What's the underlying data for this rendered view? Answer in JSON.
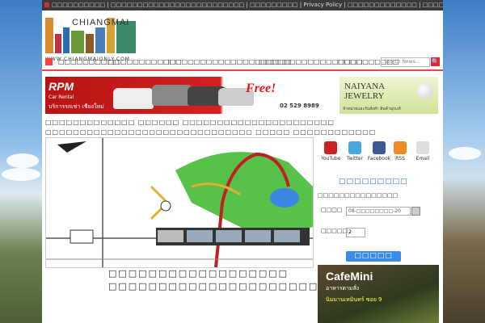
{
  "topbar": {
    "items": [
      "□□□□□□□□□□ | □□□□□□□□□□□□□□□□□□□□□□□□□ | □□□□□□□□□ | Privacy Policy | □□□□□□□□□□□□□ | □□□□□□□□□□□□□□□□□□□□□□□□"
    ]
  },
  "logo": {
    "text": "CHIANGMAI",
    "url": "WWW.CHIANGMAIONLY.COM"
  },
  "nav": {
    "items": [
      "□□□□□□□□□□",
      "□□□□□□□□□□□□",
      "□□□□□□□□□□□□□□□□□□□□□",
      "□□□□□□□□□□□□□□□□□",
      "□□□□□□□□□□"
    ],
    "search_placeholder": "Search News...",
    "search_button": "🔍"
  },
  "ads": {
    "rpm": {
      "brand": "RPM",
      "sub": "Car Rental",
      "tagline": "บริการรถเช่า เชียงใหม่",
      "free": "Free!",
      "phone": "02 529 8989"
    },
    "jewelry": {
      "title_1": "NAIYANA",
      "title_2": "JEWELRY",
      "sub": "จำหน่ายและรับสั่งทำ สินค้ามุกแท้"
    }
  },
  "article": {
    "headline": "□□□□□□□□□□□□□ □□□□□□ □□□□□□□□□□□□□□□□□□□□□□ □□□□□□□□□□□□□□□□□□□□□□□□□□□□□□ □□□□□ □□□□□□□□□□□□",
    "caption": "□□□□□□□□□□□□□□□□□□ □□□□□□□□□□□□□□□□□□□□□□□□□□□□□□□□"
  },
  "social": [
    {
      "label": "YouTube",
      "icon": "youtube-icon",
      "color": "#cc2222"
    },
    {
      "label": "Twitter",
      "icon": "twitter-icon",
      "color": "#4aa8e0"
    },
    {
      "label": "Facebook",
      "icon": "facebook-icon",
      "color": "#3b5998"
    },
    {
      "label": "RSS",
      "icon": "rss-icon",
      "color": "#f08a24"
    },
    {
      "label": "Email",
      "icon": "email-icon",
      "color": "#dddddd"
    }
  ],
  "booking": {
    "title": "□□□□□□□□□",
    "field_1": "□□□□□□□□□□□□□□□",
    "date_label": "□□□□",
    "date_value": "08-□□□□□□□□-20",
    "qty_label": "□□□□□",
    "qty_value": "2",
    "button": "□□□□□"
  },
  "cafe_ad": {
    "name": "CafeMini",
    "sub": "อาหารตามสั่ง",
    "location": "นิมมานเหมินทร์ ซอย 9"
  }
}
